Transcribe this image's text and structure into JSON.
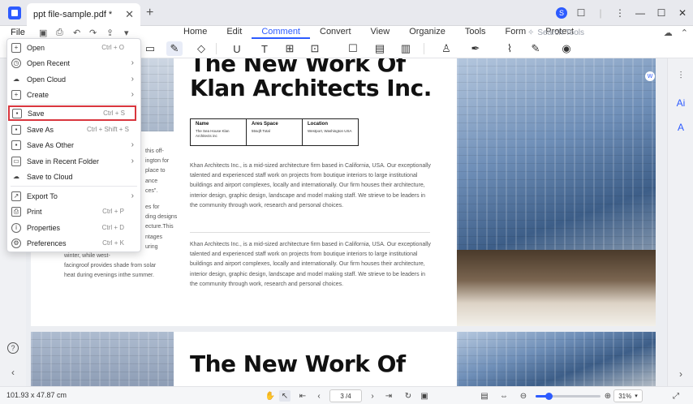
{
  "titlebar": {
    "tab_title": "ppt file-sample.pdf *",
    "tab_close": "✕",
    "add_tab": "+",
    "avatar_letter": "S"
  },
  "menubar": {
    "file_label": "File",
    "tabs": [
      "Home",
      "Edit",
      "Comment",
      "Convert",
      "View",
      "Organize",
      "Tools",
      "Form",
      "Protect"
    ],
    "active_tab": "Comment",
    "search_placeholder": "Search Tools"
  },
  "file_menu": {
    "items": [
      {
        "label": "Open",
        "shortcut": "Ctrl + O",
        "submenu": false,
        "icon": "plus-box-icon"
      },
      {
        "label": "Open Recent",
        "shortcut": "",
        "submenu": true,
        "icon": "clock-icon"
      },
      {
        "label": "Open Cloud",
        "shortcut": "",
        "submenu": true,
        "icon": "cloud-icon"
      },
      {
        "label": "Create",
        "shortcut": "",
        "submenu": true,
        "icon": "new-file-icon"
      },
      {
        "label": "Save",
        "shortcut": "Ctrl + S",
        "submenu": false,
        "icon": "save-icon",
        "highlighted": true
      },
      {
        "label": "Save As",
        "shortcut": "Ctrl + Shift + S",
        "submenu": false,
        "icon": "save-as-icon"
      },
      {
        "label": "Save As Other",
        "shortcut": "",
        "submenu": true,
        "icon": "save-other-icon"
      },
      {
        "label": "Save in Recent Folder",
        "shortcut": "",
        "submenu": true,
        "icon": "folder-icon"
      },
      {
        "label": "Save to Cloud",
        "shortcut": "",
        "submenu": false,
        "icon": "cloud-upload-icon"
      },
      {
        "label": "Export To",
        "shortcut": "",
        "submenu": true,
        "icon": "export-icon"
      },
      {
        "label": "Print",
        "shortcut": "Ctrl + P",
        "submenu": false,
        "icon": "print-icon"
      },
      {
        "label": "Properties",
        "shortcut": "Ctrl + D",
        "submenu": false,
        "icon": "info-icon"
      },
      {
        "label": "Preferences",
        "shortcut": "Ctrl + K",
        "submenu": false,
        "icon": "gear-icon"
      }
    ]
  },
  "document": {
    "heading_line1": "The New Work Of",
    "heading_line2": "Klan Architects Inc.",
    "page2_heading": "The New Work Of",
    "table": {
      "headers": [
        "Name",
        "Ares Space",
        "Location"
      ],
      "values": [
        "The Sea House Klan Architects inc",
        "55sqft Total",
        "Westport, Washington USA"
      ]
    },
    "paragraph": "Khan Architects Inc., is a mid-sized architecture firm based in California, USA. Our exceptionally talented and experienced staff work on projects from boutique interiors to large institutional buildings and airport complexes, locally and internationally. Our firm houses their architecture, interior design, graphic design, landscape and model making staff. We strieve to be leaders in the community through work, research and personal choices.",
    "left_fragments": [
      "this off-",
      "ington for",
      "place to",
      "ance",
      "ces\".",
      "es for",
      "ding designs",
      "ecture.This",
      "ntages",
      "uring",
      "winter, while west-",
      "facingroof provides shade from solar",
      "heat during evenings inthe summer."
    ]
  },
  "statusbar": {
    "dimensions": "101.93 x 47.87 cm",
    "page_indicator": "3 /4",
    "zoom_level": "31%"
  }
}
